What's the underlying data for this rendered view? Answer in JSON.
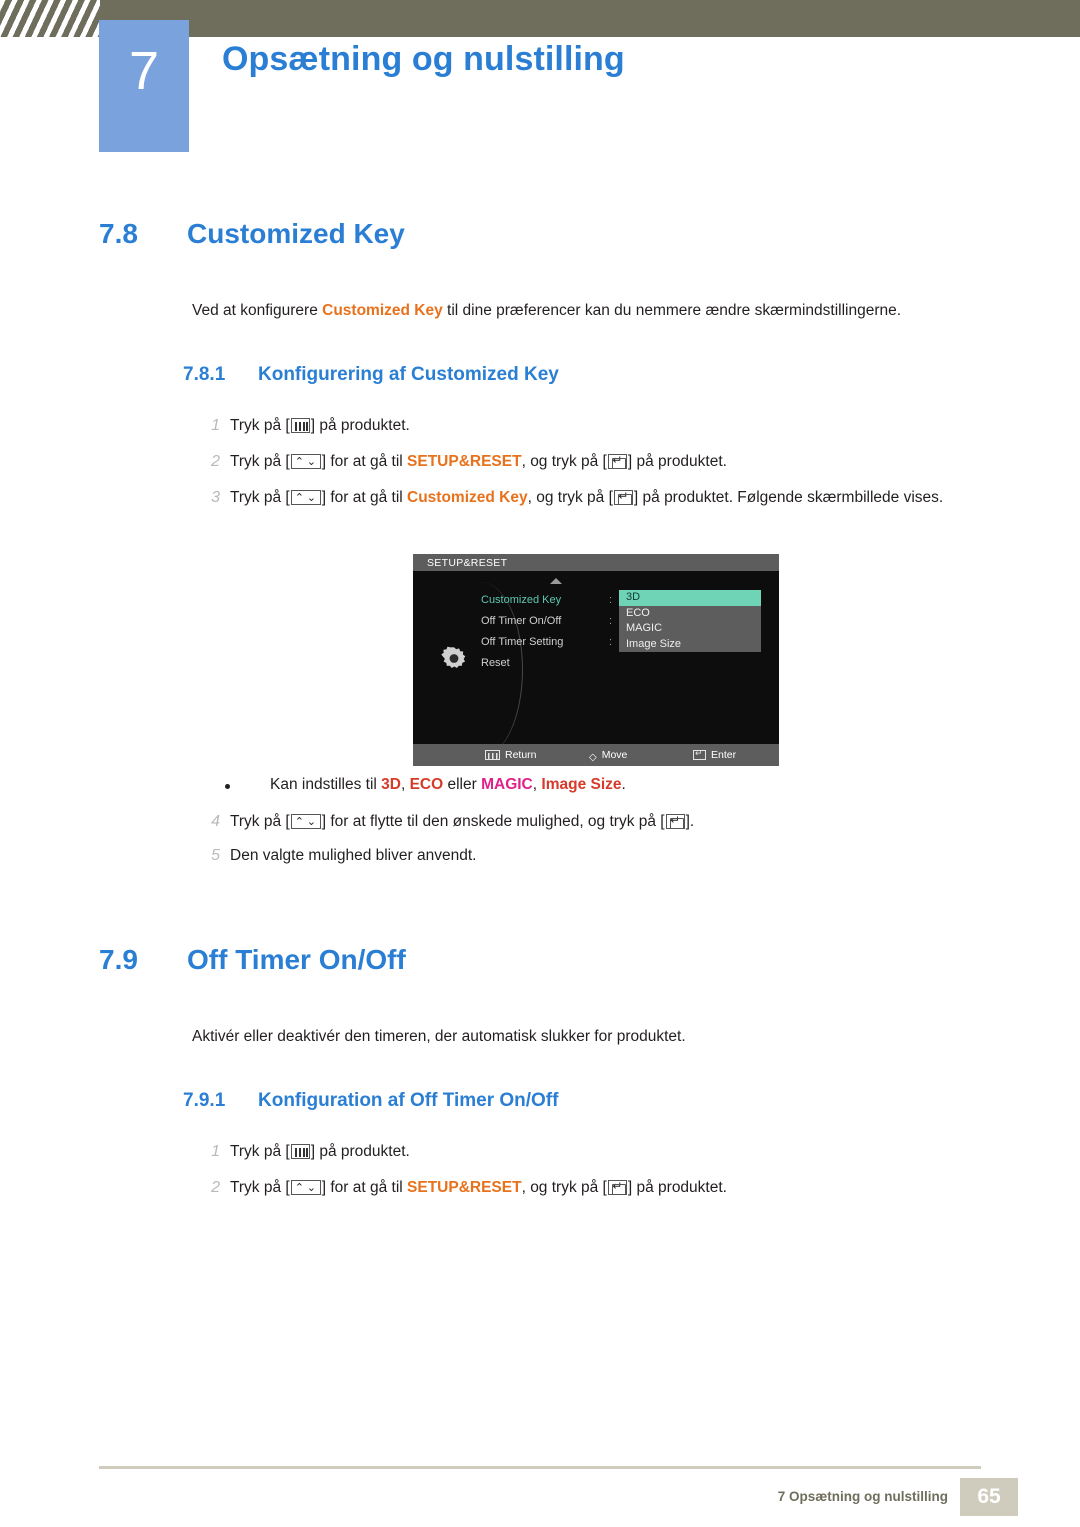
{
  "header": {
    "chapter_number": "7",
    "chapter_title": "Opsætning og nulstilling"
  },
  "sections": {
    "customized_key": {
      "number": "7.8",
      "title": "Customized Key",
      "intro_before": "Ved at konfigurere ",
      "intro_highlight": "Customized Key",
      "intro_after": " til dine præferencer kan du nemmere ændre skærmindstillingerne.",
      "sub_number": "7.8.1",
      "sub_title": "Konfigurering af Customized Key",
      "steps": [
        {
          "index": "1",
          "parts": [
            "Tryk på [",
            "] på produktet."
          ]
        },
        {
          "index": "2",
          "parts": [
            "Tryk på [",
            "] for at gå til ",
            "SETUP&RESET",
            ", og tryk på [",
            "] på produktet."
          ]
        },
        {
          "index": "3",
          "parts": [
            "Tryk på [",
            "] for at gå til ",
            "Customized Key",
            ", og tryk på [",
            "] på produktet. Følgende skærmbillede vises."
          ]
        },
        {
          "index": "4",
          "parts": [
            "Tryk på [",
            "] for at flytte til den ønskede mulighed, og tryk på [",
            "]."
          ]
        },
        {
          "index": "5",
          "parts": [
            "Den valgte mulighed bliver anvendt."
          ]
        }
      ],
      "bullet": {
        "prefix": "Kan indstilles til ",
        "opt1": "3D",
        "sep1": ", ",
        "opt2": "ECO",
        "sep2": " eller ",
        "opt3": "MAGIC",
        "sep3": ", ",
        "opt4": "Image Size",
        "suffix": "."
      }
    },
    "off_timer": {
      "number": "7.9",
      "title": "Off Timer On/Off",
      "intro": "Aktivér eller deaktivér den timeren, der automatisk slukker for produktet.",
      "sub_number": "7.9.1",
      "sub_title": "Konfiguration af Off Timer On/Off",
      "steps": [
        {
          "index": "1",
          "parts": [
            "Tryk på [",
            "] på produktet."
          ]
        },
        {
          "index": "2",
          "parts": [
            "Tryk på [",
            "] for at gå til ",
            "SETUP&RESET",
            ", og tryk på [",
            "] på produktet."
          ]
        }
      ]
    }
  },
  "osd": {
    "title": "SETUP&RESET",
    "menu_items": [
      {
        "label": "Customized Key",
        "active": true
      },
      {
        "label": "Off Timer On/Off",
        "active": false
      },
      {
        "label": "Off Timer Setting",
        "active": false
      },
      {
        "label": "Reset",
        "active": false
      }
    ],
    "submenu_items": [
      {
        "label": "3D",
        "selected": true
      },
      {
        "label": "ECO",
        "selected": false
      },
      {
        "label": "MAGIC",
        "selected": false
      },
      {
        "label": "Image Size",
        "selected": false
      }
    ],
    "footer": {
      "return": "Return",
      "move": "Move",
      "enter": "Enter"
    }
  },
  "footer": {
    "text": "7 Opsætning og nulstilling",
    "page": "65"
  },
  "colors": {
    "accent_blue": "#2a7fd4",
    "badge_blue": "#7aa3dd",
    "header_olive": "#6f6d5c",
    "orange": "#e8721c",
    "red": "#d63b2a",
    "magenta": "#e0218a",
    "osd_select_green": "#6fd3b6"
  }
}
